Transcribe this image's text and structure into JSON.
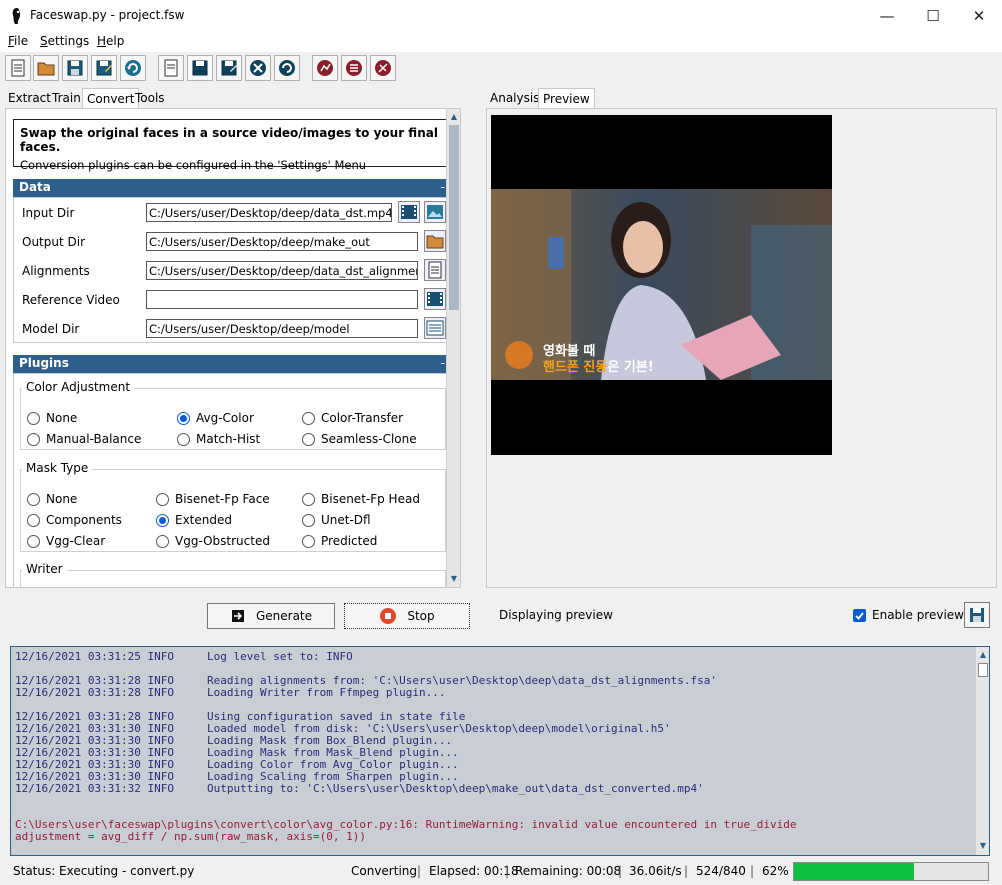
{
  "window": {
    "title": "Faceswap.py - project.fsw"
  },
  "menu": [
    {
      "label": "File",
      "u": "F",
      "rest": "ile"
    },
    {
      "label": "Settings",
      "u": "S",
      "rest": "ettings"
    },
    {
      "label": "Help",
      "u": "H",
      "rest": "elp"
    }
  ],
  "left_tabs": [
    "Extract",
    "Train",
    "Convert",
    "Tools"
  ],
  "right_tabs": [
    "Analysis",
    "Preview"
  ],
  "info": {
    "title": "Swap the original faces in a source video/images to your final faces.",
    "subtitle": "Conversion plugins can be configured in the 'Settings' Menu"
  },
  "data_section": {
    "title": "Data",
    "collapse": "-",
    "fields": [
      {
        "label": "Input Dir",
        "value": "C:/Users/user/Desktop/deep/data_dst.mp4"
      },
      {
        "label": "Output Dir",
        "value": "C:/Users/user/Desktop/deep/make_out"
      },
      {
        "label": "Alignments",
        "value": "C:/Users/user/Desktop/deep/data_dst_alignments.f"
      },
      {
        "label": "Reference Video",
        "value": ""
      },
      {
        "label": "Model Dir",
        "value": "C:/Users/user/Desktop/deep/model"
      }
    ]
  },
  "plugins_section": {
    "title": "Plugins",
    "collapse": "-",
    "color_adjustment": {
      "title": "Color Adjustment",
      "options": [
        "None",
        "Avg-Color",
        "Color-Transfer",
        "Manual-Balance",
        "Match-Hist",
        "Seamless-Clone"
      ],
      "selected": "Avg-Color"
    },
    "mask_type": {
      "title": "Mask Type",
      "options": [
        "None",
        "Bisenet-Fp Face",
        "Bisenet-Fp Head",
        "Components",
        "Extended",
        "Unet-Dfl",
        "Vgg-Clear",
        "Vgg-Obstructed",
        "Predicted"
      ],
      "selected": "Extended"
    },
    "writer": {
      "title": "Writer"
    }
  },
  "preview": {
    "caption_line1": "영화볼 때",
    "caption_line2_a": "핸드폰 진동",
    "caption_line2_b": "은 기본!",
    "status": "Displaying preview",
    "enable_label": "Enable preview",
    "enabled": true
  },
  "buttons": {
    "generate": "Generate",
    "stop": "Stop"
  },
  "console": {
    "lines": [
      "12/16/2021 03:31:25 INFO     Log level set to: INFO",
      "",
      "12/16/2021 03:31:28 INFO     Reading alignments from: 'C:\\Users\\user\\Desktop\\deep\\data_dst_alignments.fsa'",
      "12/16/2021 03:31:28 INFO     Loading Writer from Ffmpeg plugin...",
      "",
      "12/16/2021 03:31:28 INFO     Using configuration saved in state file",
      "12/16/2021 03:31:30 INFO     Loaded model from disk: 'C:\\Users\\user\\Desktop\\deep\\model\\original.h5'",
      "12/16/2021 03:31:30 INFO     Loading Mask from Box_Blend plugin...",
      "12/16/2021 03:31:30 INFO     Loading Mask from Mask_Blend plugin...",
      "12/16/2021 03:31:30 INFO     Loading Color from Avg_Color plugin...",
      "12/16/2021 03:31:30 INFO     Loading Scaling from Sharpen plugin...",
      "12/16/2021 03:31:32 INFO     Outputting to: 'C:\\Users\\user\\Desktop\\deep\\make_out\\data_dst_converted.mp4'",
      "",
      ""
    ],
    "warning_lines": [
      "C:\\Users\\user\\faceswap\\plugins\\convert\\color\\avg_color.py:16: RuntimeWarning: invalid value encountered in true_divide",
      "adjustment = avg_diff / np.sum(raw_mask, axis=(0, 1))"
    ]
  },
  "status": {
    "label": "Status:",
    "text": "Executing - convert.py",
    "converting": "Converting",
    "elapsed": "Elapsed: 00:18",
    "remaining": "Remaining: 00:08",
    "rate": "36.06it/s",
    "count": "524/840",
    "percent": "62%",
    "progress": 0.62
  },
  "colors": {
    "accent": "#2e5f8a",
    "progress": "#10c040",
    "radio": "#0a5ad4",
    "warn": "#9a1b3a",
    "log": "#2b2b7a"
  }
}
